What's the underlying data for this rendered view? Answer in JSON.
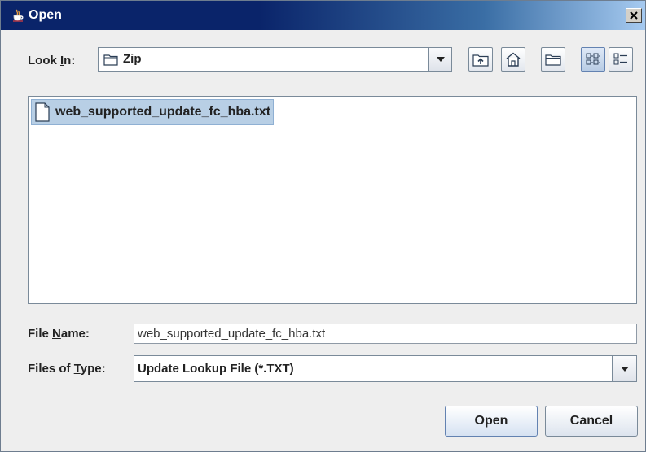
{
  "window": {
    "title": "Open"
  },
  "look_in": {
    "label_prefix": "Look ",
    "label_mnemonic": "I",
    "label_suffix": "n:",
    "value": "Zip"
  },
  "toolbar": {
    "buttons": [
      {
        "icon": "up-one-level-icon"
      },
      {
        "icon": "home-icon"
      },
      {
        "icon": "new-folder-icon"
      },
      {
        "icon": "list-view-icon",
        "selected": true
      },
      {
        "icon": "details-view-icon",
        "selected": false
      }
    ]
  },
  "file_list": {
    "items": [
      {
        "name": "web_supported_update_fc_hba.txt",
        "selected": true
      }
    ]
  },
  "file_name": {
    "label_prefix": "File ",
    "label_mnemonic": "N",
    "label_suffix": "ame:",
    "value": "web_supported_update_fc_hba.txt"
  },
  "files_of_type": {
    "label_prefix": "Files of ",
    "label_mnemonic": "T",
    "label_suffix": "ype:",
    "value": "Update Lookup File (*.TXT)"
  },
  "buttons": {
    "open_label": "Open",
    "cancel_label": "Cancel"
  },
  "colors": {
    "titlebar_start": "#0a246a",
    "titlebar_end": "#a6caf0",
    "selection": "#b8cfe5",
    "background": "#eeeeee"
  }
}
